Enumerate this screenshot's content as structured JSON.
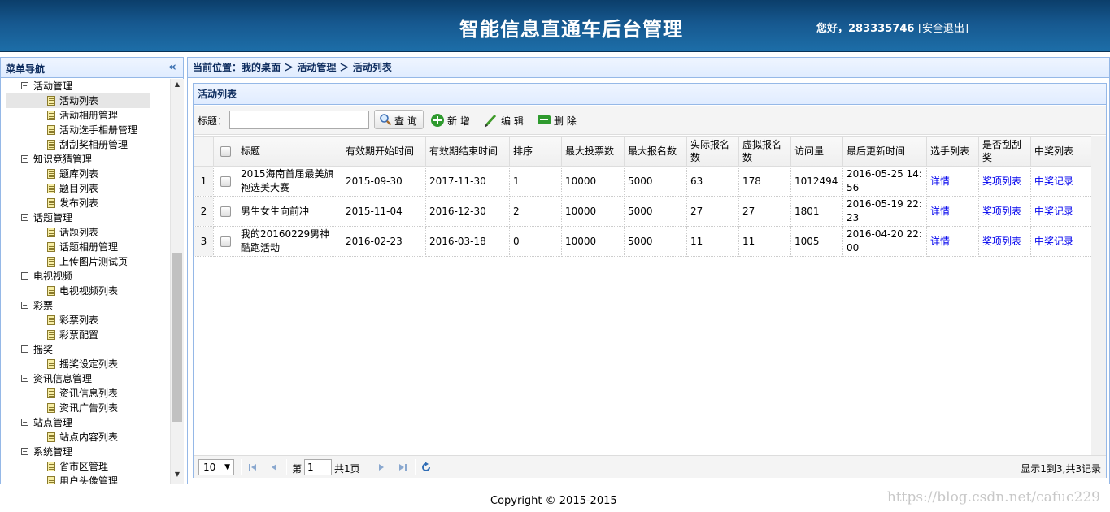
{
  "header": {
    "title": "智能信息直通车后台管理",
    "greeting": "您好，283335746",
    "logout": "[安全退出]"
  },
  "sidebar": {
    "title": "菜单导航",
    "collapse_icon": "double-chevron-left-icon",
    "tree": [
      {
        "label": "活动管理",
        "children": [
          "活动列表",
          "活动相册管理",
          "活动选手相册管理",
          "刮刮奖相册管理"
        ],
        "selected": "活动列表"
      },
      {
        "label": "知识竞猜管理",
        "children": [
          "题库列表",
          "题目列表",
          "发布列表"
        ]
      },
      {
        "label": "话题管理",
        "children": [
          "话题列表",
          "话题相册管理",
          "上传图片测试页"
        ]
      },
      {
        "label": "电视视频",
        "children": [
          "电视视频列表"
        ]
      },
      {
        "label": "彩票",
        "children": [
          "彩票列表",
          "彩票配置"
        ]
      },
      {
        "label": "摇奖",
        "children": [
          "摇奖设定列表"
        ]
      },
      {
        "label": "资讯信息管理",
        "children": [
          "资讯信息列表",
          "资讯广告列表"
        ]
      },
      {
        "label": "站点管理",
        "children": [
          "站点内容列表"
        ]
      },
      {
        "label": "系统管理",
        "children": [
          "省市区管理",
          "用户头像管理"
        ]
      }
    ]
  },
  "breadcrumb": "当前位置：我的桌面 ＞ 活动管理 ＞ 活动列表",
  "panel": {
    "title": "活动列表"
  },
  "toolbar": {
    "title_label": "标题：",
    "search_value": "",
    "query_label": "查 询",
    "add_label": "新 增",
    "edit_label": "编 辑",
    "delete_label": "删 除"
  },
  "grid": {
    "columns": [
      "标题",
      "有效期开始时间",
      "有效期结束时间",
      "排序",
      "最大投票数",
      "最大报名数",
      "实际报名数",
      "虚拟报名数",
      "访问量",
      "最后更新时间",
      "选手列表",
      "是否刮刮奖",
      "中奖列表"
    ],
    "rows": [
      {
        "n": "1",
        "title": "2015海南首届最美旗袍选美大赛",
        "start": "2015-09-30",
        "end": "2017-11-30",
        "sort": "1",
        "max_vote": "10000",
        "max_signup": "5000",
        "actual": "63",
        "virtual": "178",
        "visits": "1012494",
        "updated": "2016-05-25 14:56",
        "players": "详情",
        "scratch": "奖项列表",
        "winners": "中奖记录"
      },
      {
        "n": "2",
        "title": "男生女生向前冲",
        "start": "2015-11-04",
        "end": "2016-12-30",
        "sort": "2",
        "max_vote": "10000",
        "max_signup": "5000",
        "actual": "27",
        "virtual": "27",
        "visits": "1801",
        "updated": "2016-05-19 22:23",
        "players": "详情",
        "scratch": "奖项列表",
        "winners": "中奖记录"
      },
      {
        "n": "3",
        "title": "我的20160229男神酷跑活动",
        "start": "2016-02-23",
        "end": "2016-03-18",
        "sort": "0",
        "max_vote": "10000",
        "max_signup": "5000",
        "actual": "11",
        "virtual": "11",
        "visits": "1005",
        "updated": "2016-04-20 22:00",
        "players": "详情",
        "scratch": "奖项列表",
        "winners": "中奖记录"
      }
    ]
  },
  "pager": {
    "page_size": "10",
    "page_prefix": "第",
    "page_number": "1",
    "page_total": "共1页",
    "info": "显示1到3,共3记录"
  },
  "footer": {
    "copyright": "Copyright © 2015-2015",
    "watermark": "https://blog.csdn.net/cafuc229"
  },
  "colors": {
    "header": "#16588f",
    "panel_border": "#95b8e7",
    "link": "#0000ee",
    "add_icon": "#2e9a2e"
  }
}
